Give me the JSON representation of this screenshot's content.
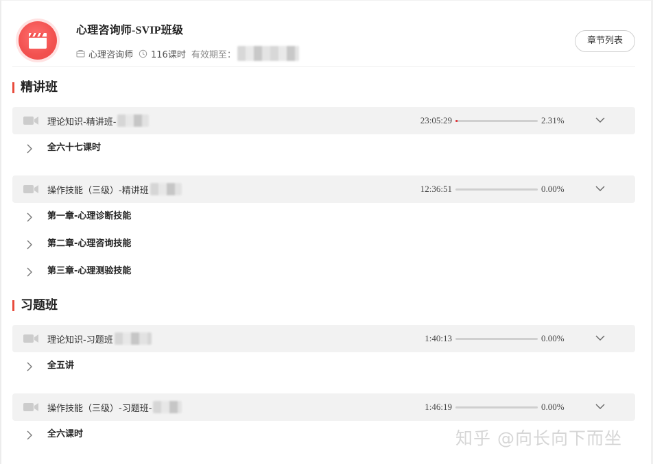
{
  "header": {
    "course_title": "心理咨询师-SVIP班级",
    "category": "心理咨询师",
    "lesson_count": "116课时",
    "expiry_label": "有效期至：",
    "chapter_list_button": "章节列表"
  },
  "sections": [
    {
      "title": "精讲班",
      "items": [
        {
          "name": "理论知识-精讲班-",
          "duration": "23:05:29",
          "progress_percent": 2.31,
          "percent_label": "2.31%",
          "subitems": [
            "全六十七课时"
          ]
        },
        {
          "name": "操作技能（三级）-精讲班",
          "duration": "12:36:51",
          "progress_percent": 0,
          "percent_label": "0.00%",
          "subitems": [
            "第一章-心理诊断技能",
            "第二章-心理咨询技能",
            "第三章-心理测验技能"
          ]
        }
      ]
    },
    {
      "title": "习题班",
      "items": [
        {
          "name": "理论知识-习题班",
          "duration": "1:40:13",
          "progress_percent": 0,
          "percent_label": "0.00%",
          "subitems": [
            "全五讲"
          ]
        },
        {
          "name": "操作技能（三级）-习题班-",
          "duration": "1:46:19",
          "progress_percent": 0,
          "percent_label": "0.00%",
          "subitems": [
            "全六课时"
          ]
        }
      ]
    }
  ],
  "watermark": "知乎 @向长向下而坐",
  "colors": {
    "accent": "#e84b3c",
    "progress_fill": "#e0343a",
    "row_bg": "#f2f2f2"
  }
}
